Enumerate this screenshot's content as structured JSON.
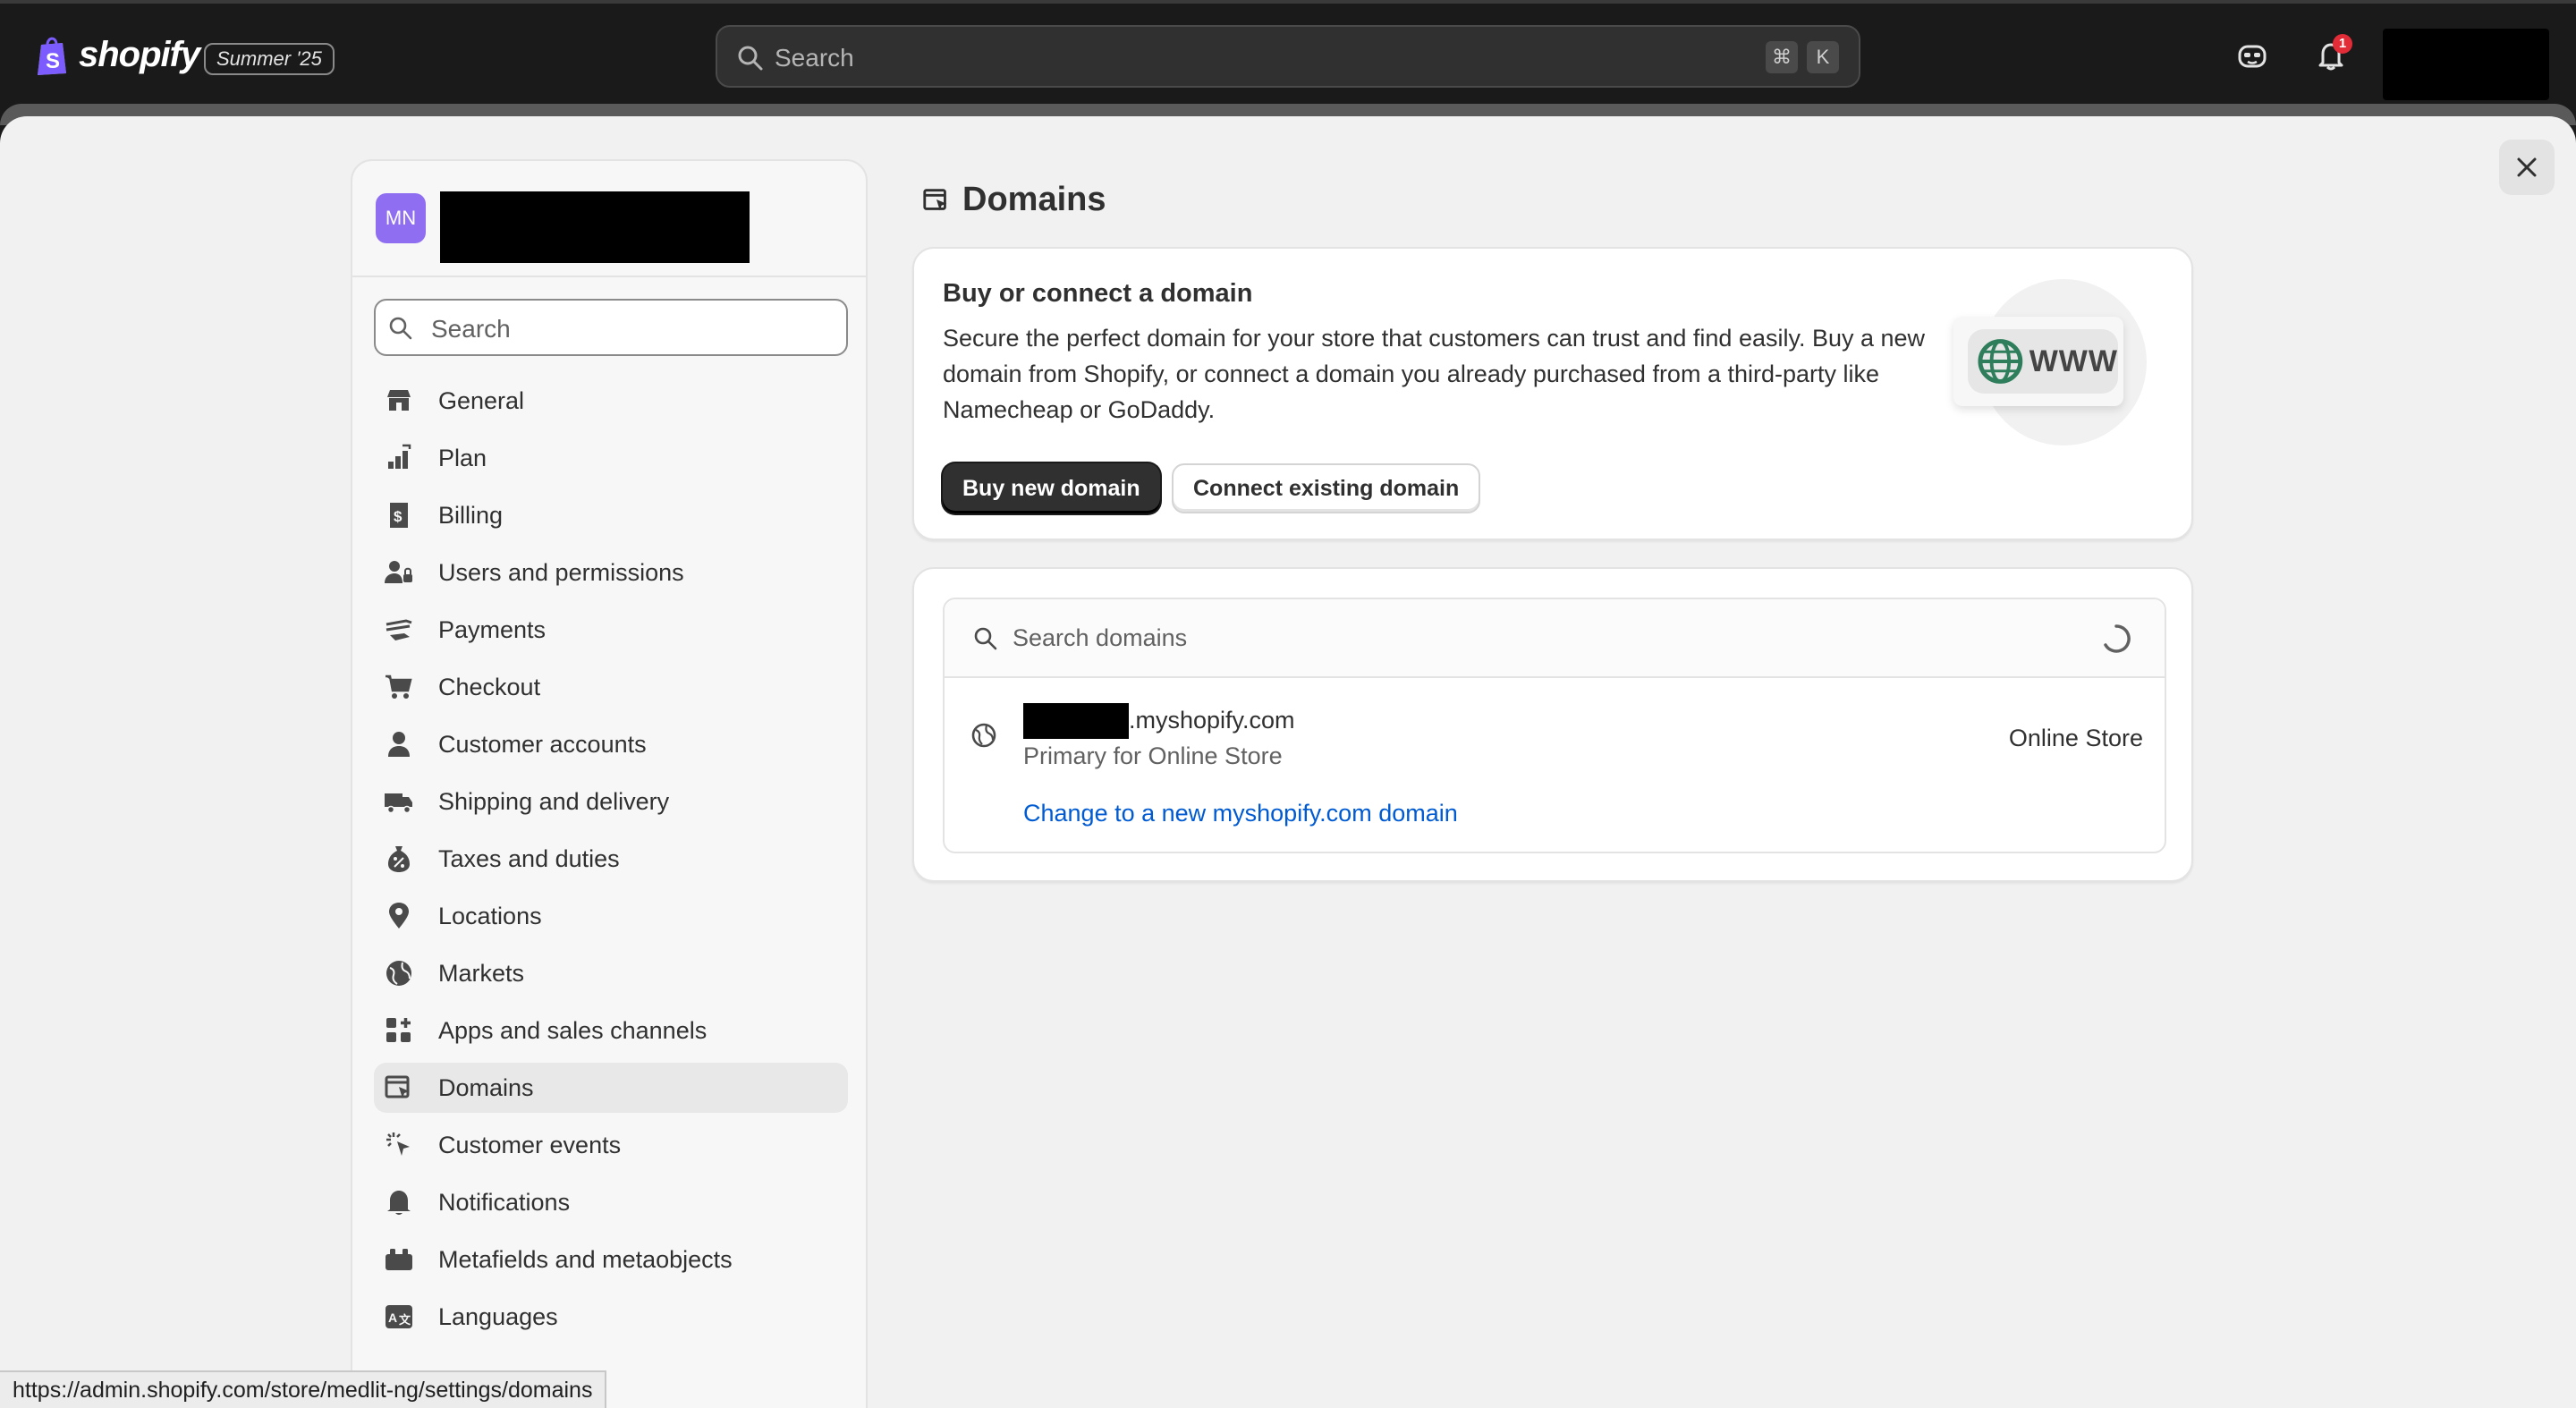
{
  "topbar": {
    "logo_text": "shopify",
    "edition_badge": "Summer '25",
    "search_placeholder": "Search",
    "shortcut_cmd": "⌘",
    "shortcut_key": "K",
    "notification_count": "1"
  },
  "sidebar": {
    "avatar_initials": "MN",
    "search_placeholder": "Search",
    "items": [
      {
        "label": "General",
        "icon": "store-icon"
      },
      {
        "label": "Plan",
        "icon": "plan-icon"
      },
      {
        "label": "Billing",
        "icon": "billing-icon"
      },
      {
        "label": "Users and permissions",
        "icon": "users-icon"
      },
      {
        "label": "Payments",
        "icon": "payments-icon"
      },
      {
        "label": "Checkout",
        "icon": "cart-icon"
      },
      {
        "label": "Customer accounts",
        "icon": "person-icon"
      },
      {
        "label": "Shipping and delivery",
        "icon": "truck-icon"
      },
      {
        "label": "Taxes and duties",
        "icon": "tax-icon"
      },
      {
        "label": "Locations",
        "icon": "location-icon"
      },
      {
        "label": "Markets",
        "icon": "globe-icon"
      },
      {
        "label": "Apps and sales channels",
        "icon": "apps-icon"
      },
      {
        "label": "Domains",
        "icon": "domains-icon",
        "active": true
      },
      {
        "label": "Customer events",
        "icon": "cursor-click-icon"
      },
      {
        "label": "Notifications",
        "icon": "bell-icon"
      },
      {
        "label": "Metafields and metaobjects",
        "icon": "metafields-icon"
      },
      {
        "label": "Languages",
        "icon": "language-icon"
      }
    ]
  },
  "main": {
    "title": "Domains",
    "buy_card": {
      "heading": "Buy or connect a domain",
      "body": "Secure the perfect domain for your store that customers can trust and find easily. Buy a new domain from Shopify, or connect a domain you already purchased from a third-party like Namecheap or GoDaddy.",
      "primary_button": "Buy new domain",
      "secondary_button": "Connect existing domain",
      "illustration_text": "WWW"
    },
    "domains_card": {
      "search_placeholder": "Search domains",
      "domain_suffix": ".myshopify.com",
      "domain_subtitle": "Primary for Online Store",
      "change_link": "Change to a new myshopify.com domain",
      "channel": "Online Store"
    }
  },
  "statusbar": {
    "url": "https://admin.shopify.com/store/medlit-ng/settings/domains"
  },
  "colors": {
    "topbar_bg": "#1a1a1a",
    "sheet_bg": "#f1f1f1",
    "avatar_bg": "#8f6ef2",
    "link": "#005bd3",
    "primary_button": "#303030",
    "notification_badge": "#e22c38"
  }
}
